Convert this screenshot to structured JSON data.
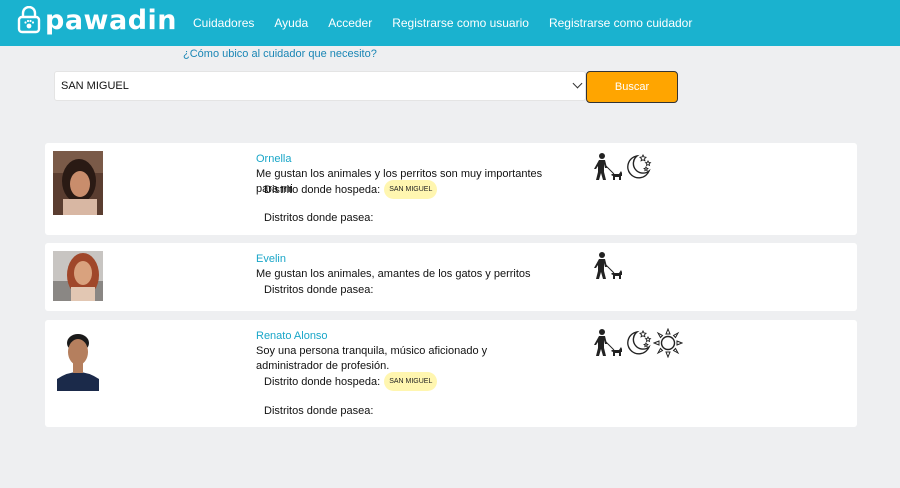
{
  "brand": {
    "name": "pawadin"
  },
  "nav": [
    {
      "label": "Cuidadores"
    },
    {
      "label": "Ayuda"
    },
    {
      "label": "Acceder"
    },
    {
      "label": "Registrarse como usuario"
    },
    {
      "label": "Registrarse como cuidador"
    }
  ],
  "help_link": "¿Cómo ubico al cuidador que necesito?",
  "search": {
    "selected": "SAN MIGUEL",
    "button": "Buscar"
  },
  "labels": {
    "hosts_in": "Distrito donde hospeda:",
    "walks_in": "Distritos donde pasea:"
  },
  "caregivers": [
    {
      "name": "Ornella",
      "description": "Me gustan los animales y los perritos son muy importantes para mi",
      "host_district": "SAN MIGUEL",
      "services": [
        "dog-walk-icon",
        "night-icon"
      ]
    },
    {
      "name": "Evelin",
      "description": "Me gustan los animales, amantes de los gatos y perritos",
      "services": [
        "dog-walk-icon"
      ]
    },
    {
      "name": "Renato Alonso",
      "description": "Soy una persona tranquila, músico aficionado y administrador de profesión.",
      "host_district": "SAN MIGUEL",
      "services": [
        "dog-walk-icon",
        "night-icon",
        "day-icon"
      ]
    }
  ]
}
